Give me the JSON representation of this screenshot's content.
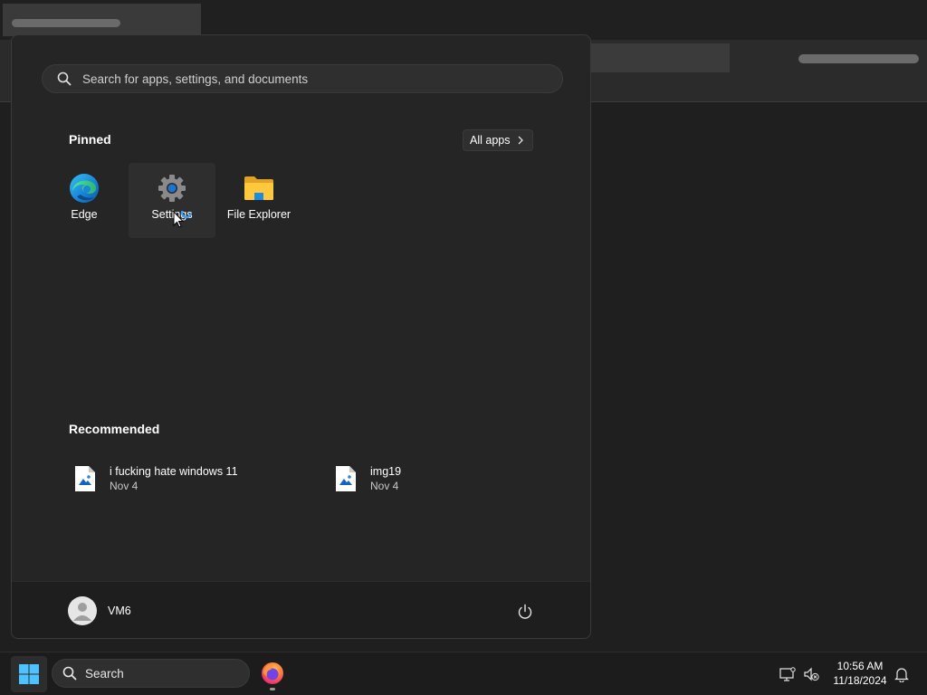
{
  "start_menu": {
    "search_placeholder": "Search for apps, settings, and documents",
    "pinned_title": "Pinned",
    "all_apps_label": "All apps",
    "pinned_apps": [
      {
        "label": "Edge",
        "icon": "edge-icon"
      },
      {
        "label": "Settings",
        "icon": "settings-gear-icon"
      },
      {
        "label": "File Explorer",
        "icon": "folder-icon"
      }
    ],
    "recommended_title": "Recommended",
    "recommended": [
      {
        "name": "i fucking hate windows 11",
        "date": "Nov 4",
        "icon": "image-file-icon"
      },
      {
        "name": "img19",
        "date": "Nov 4",
        "icon": "image-file-icon"
      }
    ],
    "user_name": "VM6"
  },
  "taskbar": {
    "search_label": "Search",
    "time": "10:56 AM",
    "date": "11/18/2024"
  },
  "colors": {
    "accent": "#0078d4",
    "menu_bg": "#252525",
    "taskbar_bg": "#1c1c1c"
  }
}
